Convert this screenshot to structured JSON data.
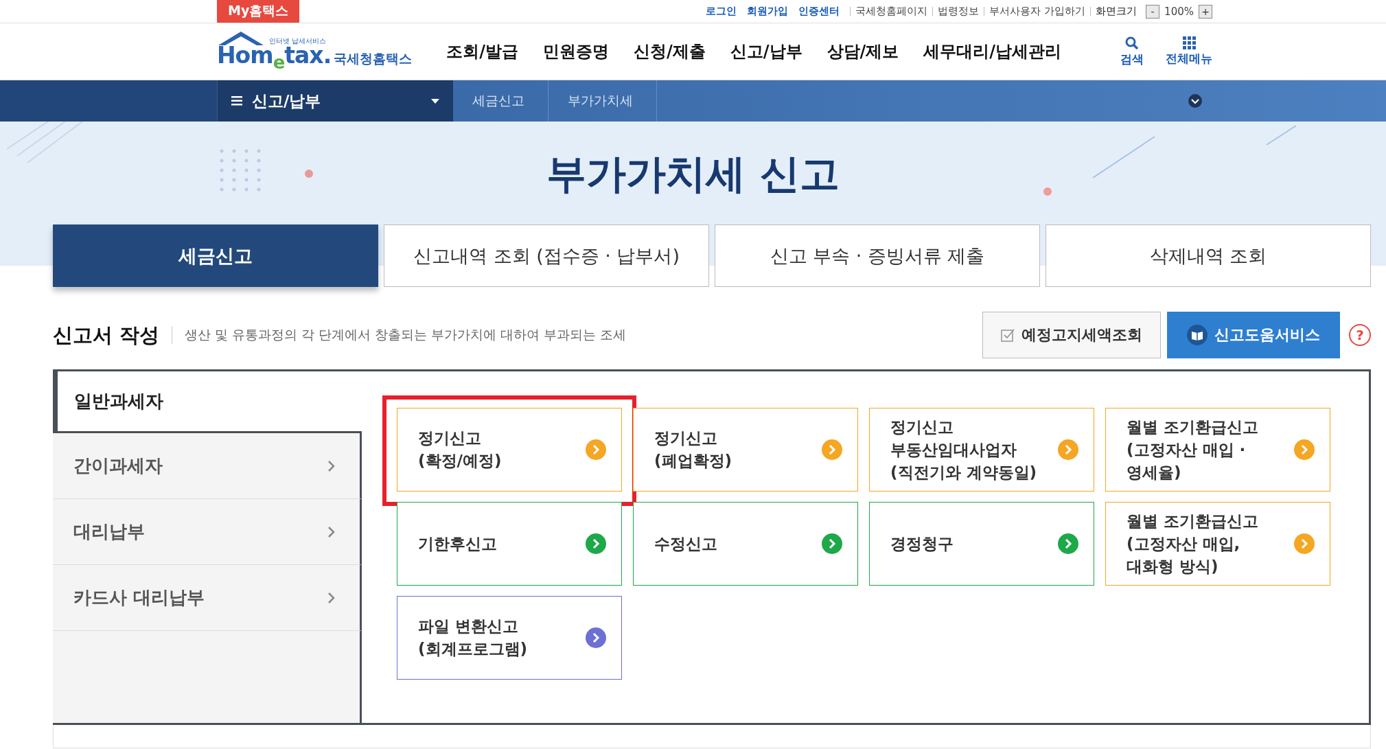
{
  "top_bar": {
    "my_tab": "My홈택스",
    "links": [
      {
        "label": "로그인",
        "kind": "primary"
      },
      {
        "label": "회원가입",
        "kind": "primary"
      },
      {
        "label": "인증센터",
        "kind": "primary"
      },
      {
        "label": "국세청홈페이지",
        "kind": "plain"
      },
      {
        "label": "법령정보",
        "kind": "plain"
      },
      {
        "label": "부서사용자 가입하기",
        "kind": "plain"
      }
    ],
    "zoom": {
      "label": "화면크기",
      "minus": "-",
      "value": "100%",
      "plus": "+"
    }
  },
  "header": {
    "logo": {
      "tagline": "인터넷 납세서비스",
      "name": "Hom$_{e}$tax.",
      "subtitle": "국세청홈택스"
    },
    "menu": [
      "조회/발급",
      "민원증명",
      "신청/제출",
      "신고/납부",
      "상담/제보",
      "세무대리/납세관리"
    ],
    "tools": [
      {
        "label": "검색",
        "kind": "search"
      },
      {
        "label": "전체메뉴",
        "kind": "grid"
      }
    ]
  },
  "nav": {
    "menu": "신고/납부",
    "crumbs": [
      "세금신고",
      "부가가치세"
    ]
  },
  "banner": {
    "title": "부가가치세 신고"
  },
  "tabs": [
    {
      "label": "세금신고",
      "selected": true
    },
    {
      "label": "신고내역 조회 (접수증 · 납부서)",
      "selected": false
    },
    {
      "label": "신고 부속 · 증빙서류 제출",
      "selected": false
    },
    {
      "label": "삭제내역 조회",
      "selected": false
    }
  ],
  "section": {
    "title": "신고서 작성",
    "description": "생산 및 유통과정의 각 단계에서 창출되는 부가가치에 대하여 부과되는 조세",
    "buttons": [
      {
        "label": "예정고지세액조회",
        "kind": "outline"
      },
      {
        "label": "신고도움서비스",
        "kind": "primary"
      }
    ],
    "help": "?"
  },
  "sidebar": {
    "items": [
      {
        "label": "일반과세자",
        "selected": true
      },
      {
        "label": "간이과세자",
        "selected": false
      },
      {
        "label": "대리납부",
        "selected": false
      },
      {
        "label": "카드사 대리납부",
        "selected": false
      }
    ]
  },
  "cards": [
    {
      "label": "정기신고\n(확정/예정)",
      "color": "#f5a623",
      "highlighted": true
    },
    {
      "label": "정기신고\n(폐업확정)",
      "color": "#f5a623",
      "highlighted": false
    },
    {
      "label": "정기신고\n부동산임대사업자\n(직전기와 계약동일)",
      "color": "#f5a623",
      "highlighted": false
    },
    {
      "label": "월별 조기환급신고\n(고정자산 매입 ·\n영세율)",
      "color": "#f5a623",
      "highlighted": false
    },
    {
      "label": "기한후신고",
      "color": "#1ea84a",
      "highlighted": false
    },
    {
      "label": "수정신고",
      "color": "#1ea84a",
      "highlighted": false
    },
    {
      "label": "경정청구",
      "color": "#1ea84a",
      "highlighted": false
    },
    {
      "label": "월별 조기환급신고\n(고정자산 매입,\n대화형 방식)",
      "color": "#f5a623",
      "highlighted": false
    },
    {
      "label": "파일 변환신고\n(회계프로그램)",
      "color": "#6c6fd4",
      "highlighted": false
    }
  ]
}
